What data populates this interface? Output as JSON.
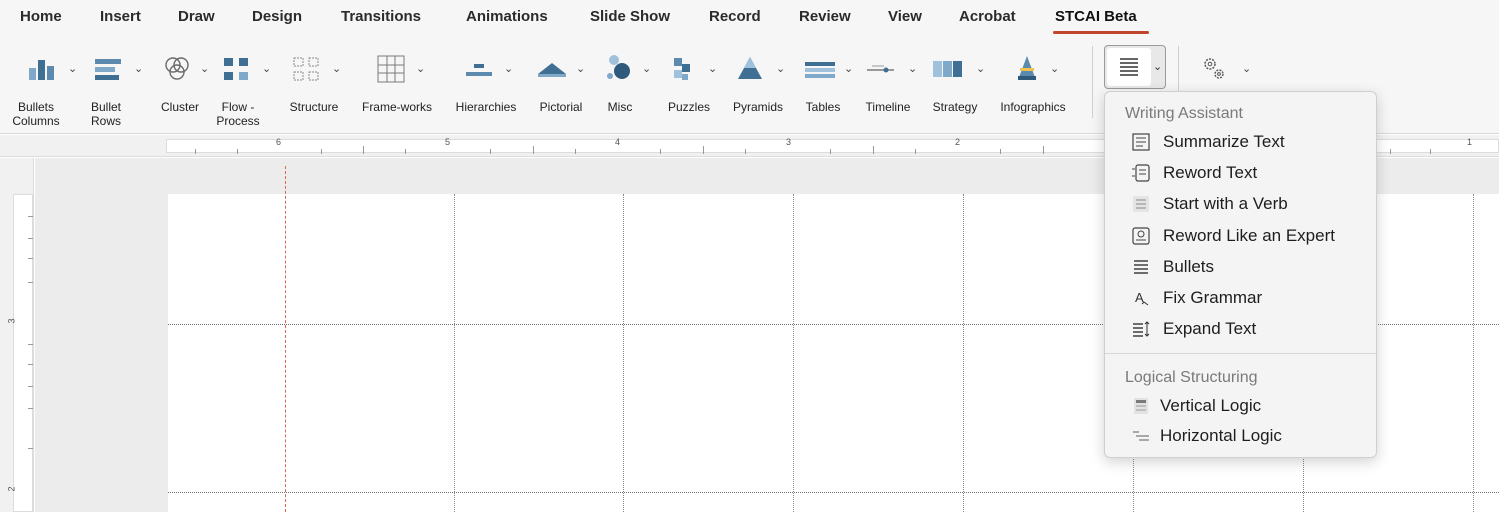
{
  "tabs": [
    {
      "label": "Home"
    },
    {
      "label": "Insert"
    },
    {
      "label": "Draw"
    },
    {
      "label": "Design"
    },
    {
      "label": "Transitions"
    },
    {
      "label": "Animations"
    },
    {
      "label": "Slide Show"
    },
    {
      "label": "Record"
    },
    {
      "label": "Review"
    },
    {
      "label": "View"
    },
    {
      "label": "Acrobat"
    },
    {
      "label": "STCAI Beta"
    }
  ],
  "active_tab": "STCAI Beta",
  "accent_color": "#c0462b",
  "ribbon": {
    "buttons": [
      {
        "label": "Bullets",
        "label2": "Columns",
        "icon": "bullets-columns-icon"
      },
      {
        "label": "Bullet",
        "label2": "Rows",
        "icon": "bullet-rows-icon"
      },
      {
        "label": "Cluster",
        "label2": "",
        "icon": "cluster-icon"
      },
      {
        "label": "Flow -",
        "label2": "Process",
        "icon": "flow-process-icon"
      },
      {
        "label": "Structure",
        "label2": "",
        "icon": "structure-icon"
      },
      {
        "label": "Frame-works",
        "label2": "",
        "icon": "frameworks-icon"
      },
      {
        "label": "Hierarchies",
        "label2": "",
        "icon": "hierarchies-icon"
      },
      {
        "label": "Pictorial",
        "label2": "",
        "icon": "pictorial-icon"
      },
      {
        "label": "Misc",
        "label2": "",
        "icon": "misc-icon"
      },
      {
        "label": "Puzzles",
        "label2": "",
        "icon": "puzzles-icon"
      },
      {
        "label": "Pyramids",
        "label2": "",
        "icon": "pyramids-icon"
      },
      {
        "label": "Tables",
        "label2": "",
        "icon": "tables-icon"
      },
      {
        "label": "Timeline",
        "label2": "",
        "icon": "timeline-icon"
      },
      {
        "label": "Strategy",
        "label2": "",
        "icon": "strategy-icon"
      },
      {
        "label": "Infographics",
        "label2": "",
        "icon": "infographics-icon"
      }
    ],
    "writing_assistant_icon": "text-lines-icon",
    "settings_icon": "gears-icon"
  },
  "ruler": {
    "numbers": [
      "6",
      "5",
      "4",
      "3",
      "2",
      "1"
    ]
  },
  "vruler": {
    "numbers": [
      "3",
      "2"
    ]
  },
  "menu": {
    "section1": "Writing Assistant",
    "items1": [
      {
        "label": "Summarize Text",
        "icon": "summarize-icon"
      },
      {
        "label": "Reword Text",
        "icon": "reword-icon"
      },
      {
        "label": "Start with a Verb",
        "icon": "verb-icon"
      },
      {
        "label": "Reword Like an Expert",
        "icon": "expert-icon"
      },
      {
        "label": "Bullets",
        "icon": "bullets-icon"
      },
      {
        "label": "Fix Grammar",
        "icon": "grammar-icon"
      },
      {
        "label": "Expand Text",
        "icon": "expand-icon"
      }
    ],
    "section2": "Logical Structuring",
    "items2": [
      {
        "label": "Vertical Logic",
        "icon": "vertical-logic-icon"
      },
      {
        "label": "Horizontal Logic",
        "icon": "horizontal-logic-icon"
      }
    ]
  }
}
